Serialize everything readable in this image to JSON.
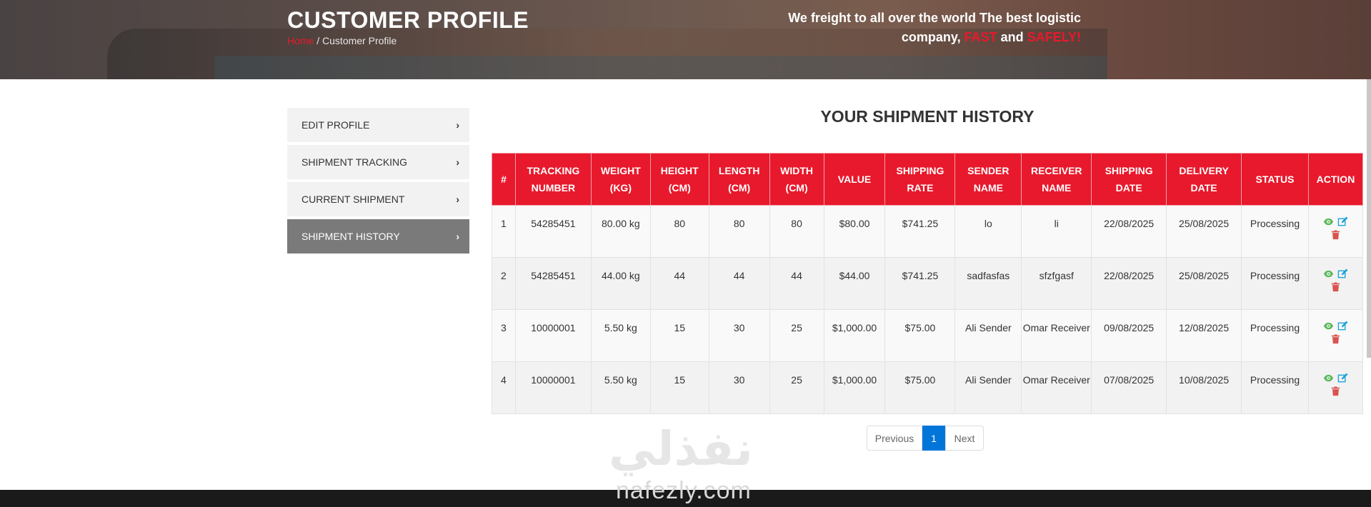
{
  "header": {
    "title": "CUSTOMER PROFILE",
    "breadcrumb_home": "Home",
    "breadcrumb_sep": " / ",
    "breadcrumb_current": "Customer Profile",
    "tagline_part1": "We freight to all over the world The best logistic company, ",
    "tagline_fast": "FAST",
    "tagline_and": " and ",
    "tagline_safely": "SAFELY!"
  },
  "sidebar": {
    "items": [
      {
        "label": "EDIT PROFILE"
      },
      {
        "label": "SHIPMENT TRACKING"
      },
      {
        "label": "CURRENT SHIPMENT"
      },
      {
        "label": "SHIPMENT HISTORY"
      }
    ],
    "chevron": "›"
  },
  "main": {
    "title": "YOUR SHIPMENT HISTORY"
  },
  "table": {
    "headers": [
      "#",
      "TRACKING NUMBER",
      "WEIGHT (KG)",
      "HEIGHT (CM)",
      "LENGTH (CM)",
      "WIDTH (CM)",
      "VALUE",
      "SHIPPING RATE",
      "SENDER NAME",
      "RECEIVER NAME",
      "SHIPPING DATE",
      "DELIVERY DATE",
      "STATUS",
      "ACTION"
    ],
    "rows": [
      [
        "1",
        "54285451",
        "80.00 kg",
        "80",
        "80",
        "80",
        "$80.00",
        "$741.25",
        "lo",
        "li",
        "22/08/2025",
        "25/08/2025",
        "Processing"
      ],
      [
        "2",
        "54285451",
        "44.00 kg",
        "44",
        "44",
        "44",
        "$44.00",
        "$741.25",
        "sadfasfas",
        "sfzfgasf",
        "22/08/2025",
        "25/08/2025",
        "Processing"
      ],
      [
        "3",
        "10000001",
        "5.50 kg",
        "15",
        "30",
        "25",
        "$1,000.00",
        "$75.00",
        "Ali Sender",
        "Omar Receiver",
        "09/08/2025",
        "12/08/2025",
        "Processing"
      ],
      [
        "4",
        "10000001",
        "5.50 kg",
        "15",
        "30",
        "25",
        "$1,000.00",
        "$75.00",
        "Ali Sender",
        "Omar Receiver",
        "07/08/2025",
        "10/08/2025",
        "Processing"
      ]
    ]
  },
  "pagination": {
    "previous": "Previous",
    "current": "1",
    "next": "Next"
  },
  "watermark": {
    "arabic": "نفذلي",
    "latin": "nafezly.com"
  },
  "colors": {
    "accent": "#e8192c",
    "active_sidebar": "#7a7a7a",
    "view_icon": "#5cb85c",
    "edit_icon": "#1fa3d8",
    "delete_icon": "#d9534f",
    "pagination_active": "#0275d8"
  },
  "icons": {
    "view": "eye-icon",
    "edit": "edit-icon",
    "delete": "trash-icon"
  }
}
